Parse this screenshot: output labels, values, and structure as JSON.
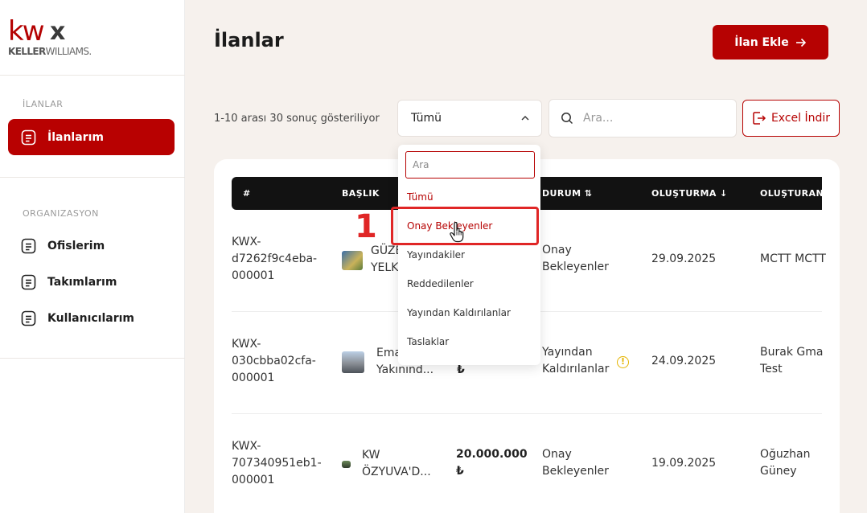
{
  "brand": {
    "kw": "kw",
    "x": "x",
    "sub_keller": "KELLER",
    "sub_williams": "WILLIAMS."
  },
  "sidebar": {
    "section1": "İLANLAR",
    "active_item": "İlanlarım",
    "section2": "ORGANIZASYON",
    "items": [
      "Ofislerim",
      "Takımlarım",
      "Kullanıcılarım"
    ]
  },
  "header": {
    "title": "İlanlar",
    "add_button": "İlan Ekle"
  },
  "toolbar": {
    "result_count": "1-10 arası 30 sonuç gösteriliyor",
    "select_value": "Tümü",
    "search_placeholder": "Ara...",
    "excel_button": "Excel İndir"
  },
  "dropdown": {
    "search_placeholder": "Ara",
    "options": [
      "Tümü",
      "Onay Bekleyenler",
      "Yayındakiler",
      "Reddedilenler",
      "Yayından Kaldırılanlar",
      "Taslaklar"
    ],
    "selected": "Tümü",
    "hovered": "Onay Bekleyenler"
  },
  "annotation": {
    "step": "1"
  },
  "table": {
    "headers": [
      "#",
      "BAŞLIK",
      "DURUM ⇅",
      "OLUŞTURMA ↓",
      "OLUŞTURAN"
    ],
    "rows": [
      {
        "id": [
          "KWX-",
          "d7262f9c4eba-",
          "000001"
        ],
        "title": [
          "GÜZE",
          "YELK"
        ],
        "price": [
          "",
          ""
        ],
        "status": [
          "Onay",
          "Bekleyenler"
        ],
        "date": "29.09.2025",
        "creator": [
          "MCTT MCTT",
          ""
        ]
      },
      {
        "id": [
          "KWX-",
          "030cbba02cfa-",
          "000001"
        ],
        "title": [
          "Ema",
          "Yakınınd..."
        ],
        "price": [
          "",
          "₺"
        ],
        "status": [
          "Yayından",
          "Kaldırılanlar"
        ],
        "date": "24.09.2025",
        "creator": [
          "Burak Gma",
          "Test"
        ]
      },
      {
        "id": [
          "KWX-",
          "707340951eb1-",
          "000001"
        ],
        "title": [
          "KW",
          "ÖZYUVA'D..."
        ],
        "price": [
          "20.000.000",
          "₺"
        ],
        "status": [
          "Onay",
          "Bekleyenler"
        ],
        "date": "19.09.2025",
        "creator": [
          "Oğuzhan",
          "Güney"
        ]
      }
    ]
  }
}
